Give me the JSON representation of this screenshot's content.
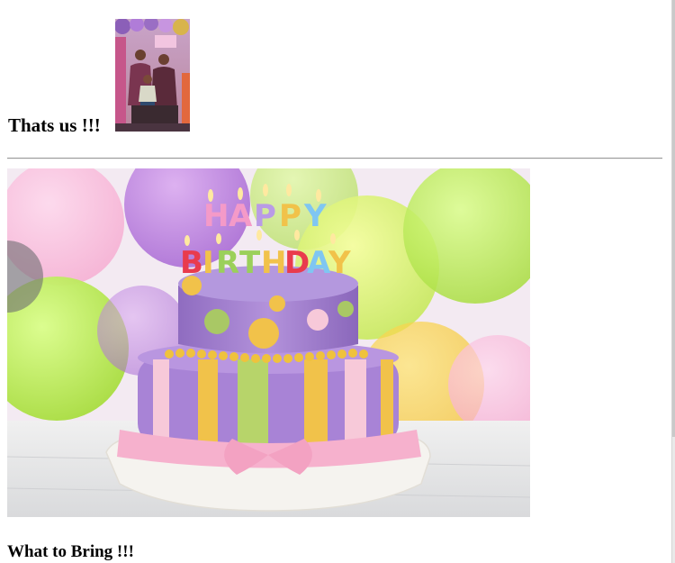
{
  "sections": {
    "family": {
      "heading": "Thats us !!!",
      "photo_icon": "family-photo"
    },
    "cake": {
      "banner_icon": "birthday-cake-image",
      "candle_letters_top": "HAPPY",
      "candle_letters_bottom": "BIRTHDAY"
    },
    "bring": {
      "heading": "What to Bring !!!"
    }
  },
  "colors": {
    "text": "#000000",
    "divider": "#9a9a9a",
    "background": "#ffffff"
  }
}
